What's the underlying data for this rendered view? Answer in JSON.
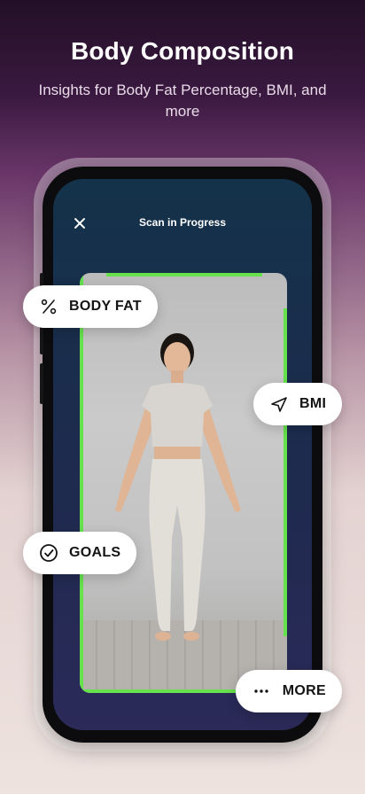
{
  "promo": {
    "headline": "Body Composition",
    "subhead": "Insights for Body Fat Percentage, BMI, and more"
  },
  "app": {
    "screen_title": "Scan in Progress",
    "close_icon": "close-icon"
  },
  "metrics": {
    "body_fat": {
      "label": "BODY FAT",
      "icon": "percent-icon"
    },
    "bmi": {
      "label": "BMI",
      "icon": "navigation-arrow-icon"
    },
    "goals": {
      "label": "GOALS",
      "icon": "check-badge-icon"
    },
    "more": {
      "label": "MORE",
      "icon": "ellipsis-icon"
    }
  },
  "colors": {
    "scan_accent": "#66e24d",
    "pill_bg": "#ffffff"
  }
}
